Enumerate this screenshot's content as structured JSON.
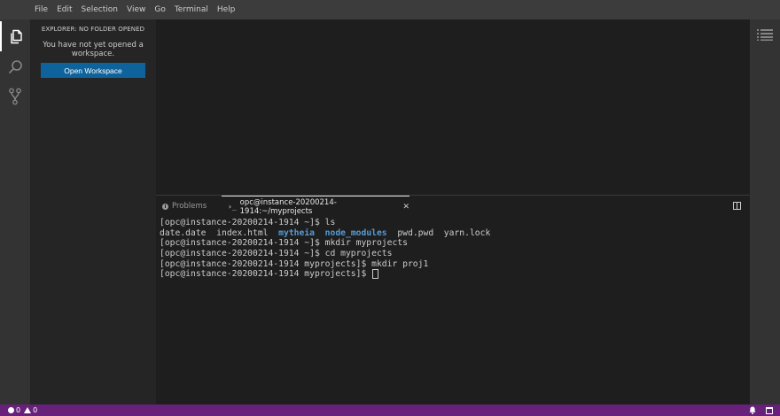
{
  "menu": [
    "File",
    "Edit",
    "Selection",
    "View",
    "Go",
    "Terminal",
    "Help"
  ],
  "activity_icons": [
    "files-icon",
    "search-icon",
    "source-control-icon"
  ],
  "explorer": {
    "title": "EXPLORER: NO FOLDER OPENED",
    "message": "You have not yet opened a workspace.",
    "button_label": "Open Workspace"
  },
  "panel": {
    "tabs": {
      "problems_label": "Problems",
      "terminal_prefix": "›_",
      "terminal_label": "opc@instance-20200214-1914:~/myprojects",
      "close_glyph": "✕"
    }
  },
  "terminal": {
    "lines": [
      [
        "[opc@instance-20200214-1914 ~]$ ls"
      ],
      [
        "date.date  index.html  ",
        {
          "dir": "mytheia"
        },
        "  ",
        {
          "dir": "node_modules"
        },
        "  pwd.pwd  yarn.lock"
      ],
      [
        "[opc@instance-20200214-1914 ~]$ mkdir myprojects"
      ],
      [
        "[opc@instance-20200214-1914 ~]$ cd myprojects"
      ],
      [
        "[opc@instance-20200214-1914 myprojects]$ mkdir proj1"
      ],
      [
        "[opc@instance-20200214-1914 myprojects]$ ",
        {
          "cursor": true
        }
      ]
    ]
  },
  "status": {
    "errors": "0",
    "warnings": "0"
  },
  "colors": {
    "accent": "#0e639c",
    "statusbar": "#68217a",
    "directory": "#569cd6"
  }
}
